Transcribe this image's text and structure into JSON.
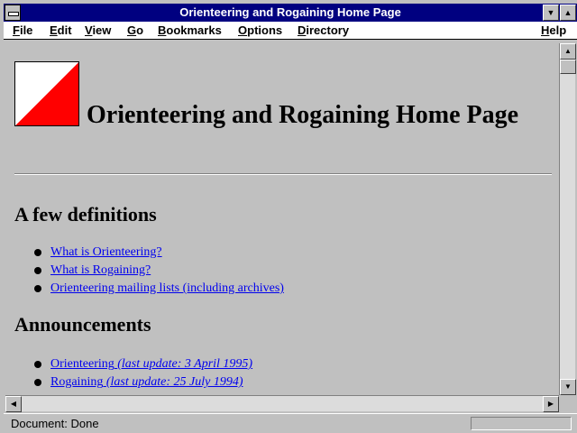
{
  "window": {
    "title": "Orienteering and Rogaining Home Page",
    "minimize_icon": "triangle-down",
    "maximize_icon": "triangle-up"
  },
  "menubar": {
    "items": [
      "File",
      "Edit",
      "View",
      "Go",
      "Bookmarks",
      "Options",
      "Directory",
      "Help"
    ]
  },
  "page": {
    "heading": "Orienteering and Rogaining Home Page",
    "definitions_heading": "A few definitions",
    "definitions": [
      "What is Orienteering?",
      "What is Rogaining?",
      "Orienteering mailing lists (including archives)"
    ],
    "announcements_heading": "Announcements",
    "announcements": [
      {
        "label": "Orienteering",
        "update": "(last update: 3 April 1995)"
      },
      {
        "label": "Rogaining",
        "update": "(last update: 25 July 1994)"
      }
    ]
  },
  "status": {
    "text": "Document: Done"
  },
  "colors": {
    "titlebar": "#000080",
    "link": "#0000ee",
    "logo_red": "#ff0000"
  }
}
